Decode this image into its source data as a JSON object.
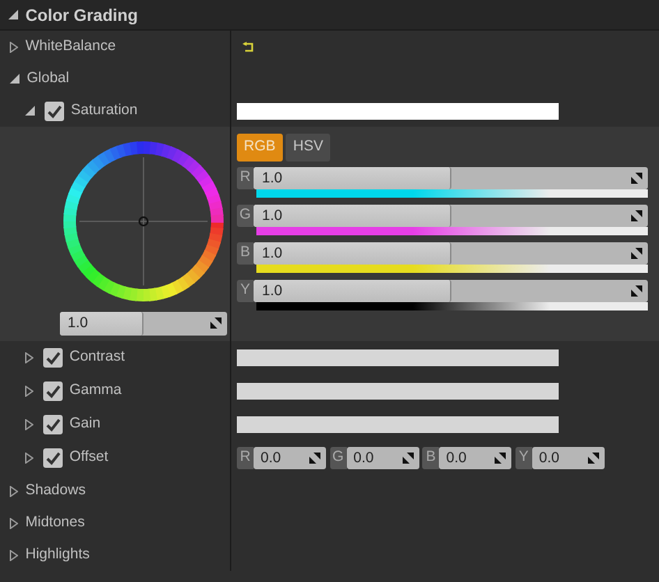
{
  "header": {
    "title": "Color Grading",
    "expanded": true
  },
  "sections": [
    {
      "label": "WhiteBalance",
      "expanded": false,
      "reset_shown": true
    },
    {
      "label": "Global",
      "expanded": true,
      "reset_shown": false,
      "children": [
        {
          "label": "Saturation",
          "kind": "wheel",
          "expanded": true,
          "checked": true,
          "color": "#ffffff",
          "wheel_value": {
            "value": "1.0",
            "level": 0.5
          },
          "modes": [
            {
              "label": "RGB",
              "selected": true
            },
            {
              "label": "HSV",
              "selected": false
            }
          ],
          "sliders": [
            {
              "channel": "R",
              "value": "1.0",
              "level": 0.5,
              "color": "#00d8ec"
            },
            {
              "channel": "G",
              "value": "1.0",
              "level": 0.5,
              "color": "#e63ee6"
            },
            {
              "channel": "B",
              "value": "1.0",
              "level": 0.5,
              "color": "#e6dc1e"
            },
            {
              "channel": "Y",
              "value": "1.0",
              "level": 0.5,
              "color": "#000000"
            }
          ]
        },
        {
          "label": "Contrast",
          "kind": "bar",
          "expanded": false,
          "checked": true,
          "color": "#d6d6d6"
        },
        {
          "label": "Gamma",
          "kind": "bar",
          "expanded": false,
          "checked": true,
          "color": "#d6d6d6"
        },
        {
          "label": "Gain",
          "kind": "bar",
          "expanded": false,
          "checked": true,
          "color": "#d6d6d6"
        },
        {
          "label": "Offset",
          "kind": "fields",
          "expanded": false,
          "checked": true,
          "fields": [
            {
              "channel": "R",
              "value": "0.0"
            },
            {
              "channel": "G",
              "value": "0.0"
            },
            {
              "channel": "B",
              "value": "0.0"
            },
            {
              "channel": "Y",
              "value": "0.0"
            }
          ]
        }
      ]
    },
    {
      "label": "Shadows",
      "expanded": false,
      "reset_shown": false
    },
    {
      "label": "Midtones",
      "expanded": false,
      "reset_shown": false
    },
    {
      "label": "Highlights",
      "expanded": false,
      "reset_shown": false
    }
  ]
}
